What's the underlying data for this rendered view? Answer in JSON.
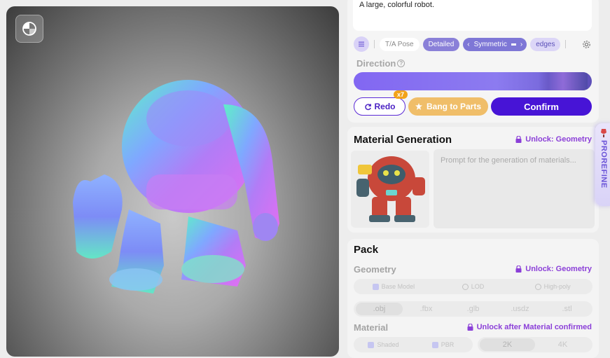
{
  "viewport": {
    "toggle_icon": "view-mode-icon"
  },
  "prompt": {
    "text": "A large, colorful robot."
  },
  "toolbar": {
    "menu_icon": "list-icon",
    "chip_tpose": "T/A Pose",
    "chip_detailed": "Detailed",
    "chip_symmetric": "Symmetric",
    "chip_edges": "edges",
    "settings_icon": "gear-icon"
  },
  "direction": {
    "label": "Direction",
    "help": "?"
  },
  "actions": {
    "redo_label": "Redo",
    "redo_badge": "x7",
    "bang_label": "Bang to Parts",
    "confirm_label": "Confirm"
  },
  "material": {
    "title": "Material Generation",
    "unlock_label": "Unlock: Geometry",
    "prompt_placeholder": "Prompt for the generation of materials..."
  },
  "pack": {
    "title": "Pack",
    "geometry_label": "Geometry",
    "geometry_unlock": "Unlock: Geometry",
    "geometry_options": [
      "Base Model",
      "LOD",
      "High-poly"
    ],
    "formats": [
      ".obj",
      ".fbx",
      ".glb",
      ".usdz",
      ".stl"
    ],
    "material_label": "Material",
    "material_unlock": "Unlock after Material confirmed",
    "material_options": [
      "Shaded",
      "PBR"
    ],
    "resolutions": [
      "2K",
      "4K"
    ]
  },
  "side_tab": {
    "label": "PROREFINE"
  },
  "colors": {
    "accent": "#4714d6",
    "unlock": "#8b3fd8",
    "bang": "#f0be69"
  }
}
